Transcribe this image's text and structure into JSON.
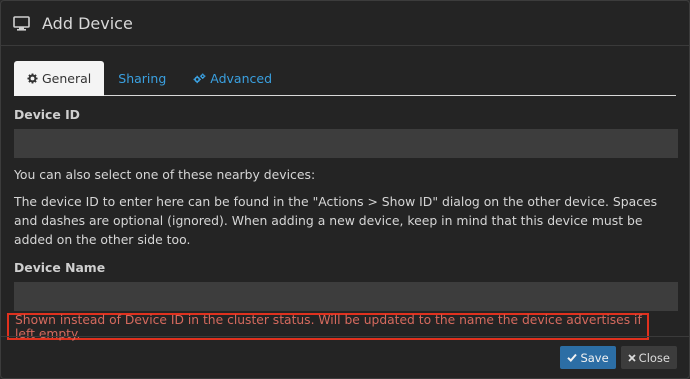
{
  "dialog": {
    "title": "Add Device",
    "icon": "monitor-icon"
  },
  "tabs": [
    {
      "label": "General",
      "icon": "gear-icon",
      "active": true
    },
    {
      "label": "Sharing",
      "icon": "",
      "active": false
    },
    {
      "label": "Advanced",
      "icon": "gears-icon",
      "active": false
    }
  ],
  "form": {
    "device_id_label": "Device ID",
    "device_id_value": "",
    "nearby_help": "You can also select one of these nearby devices:",
    "device_id_help": "The device ID to enter here can be found in the \"Actions > Show ID\" dialog on the other device. Spaces and dashes are optional (ignored). When adding a new device, keep in mind that this device must be added on the other side too.",
    "device_name_label": "Device Name",
    "device_name_value": "",
    "device_name_help": "Shown instead of Device ID in the cluster status. Will be updated to the name the device advertises if left empty."
  },
  "footer": {
    "save_label": "Save",
    "close_label": "Close"
  },
  "colors": {
    "accent": "#3aa0e0",
    "save_button": "#2c6ea5",
    "highlight_border": "#e0311e"
  }
}
